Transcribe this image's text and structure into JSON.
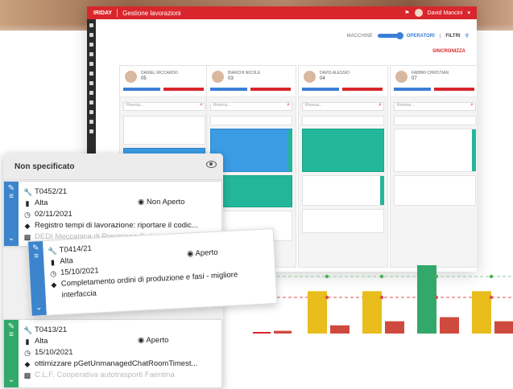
{
  "app": {
    "brand": "IRIDAY",
    "title": "Gestione lavorazioni",
    "user": "David Mancini",
    "toolbar": {
      "mode_left": "MACCHINE",
      "mode_right": "OPERATORI",
      "filters": "FILTRI",
      "sync": "SINCRONIZZA"
    },
    "columns": [
      {
        "name": "DANIEL RICCARDO",
        "num": "05",
        "search": "Ricerca..."
      },
      {
        "name": "BIANCHI NICOLE",
        "num": "03",
        "search": "Ricerca..."
      },
      {
        "name": "DAVIS ALESSIO",
        "num": "04",
        "search": "Ricerca..."
      },
      {
        "name": "FABBRI CHRISTIAN",
        "num": "07",
        "search": "Ricerca..."
      }
    ]
  },
  "popup": {
    "title": "Non specificato",
    "tasks": [
      {
        "code": "T0452/21",
        "priority": "Alta",
        "status": "Non Aperto",
        "date": "02/11/2021",
        "desc": "Registro tempi di lavorazione: riportare il codic...",
        "company": "DEDI Meccanica di Precisione S.r.l."
      },
      {
        "code": "T0414/21",
        "priority": "Alta",
        "status": "Aperto",
        "date": "15/10/2021",
        "desc": "Completamento ordini di produzione e fasi - migliore",
        "desc2": "interfaccia"
      },
      {
        "code": "T0413/21",
        "priority": "Alta",
        "status": "Aperto",
        "date": "15/10/2021",
        "desc": "ottimizzare pGetUnmanagedChatRoomTimest...",
        "company": "C.L.F. Cooperativa autotrasporti Faentina"
      }
    ]
  },
  "colors": {
    "accent": "#d9262c",
    "blue": "#3c84cc",
    "green": "#32a86a",
    "teal": "#23b79a",
    "yellow": "#e8bd1c"
  },
  "chart_data": {
    "type": "bar",
    "series": [
      {
        "values": [
          0,
          62,
          62,
          100,
          62
        ]
      },
      {
        "values": [
          4,
          12,
          18,
          24,
          18
        ]
      }
    ],
    "categories": [
      "",
      "",
      "",
      "",
      ""
    ]
  }
}
